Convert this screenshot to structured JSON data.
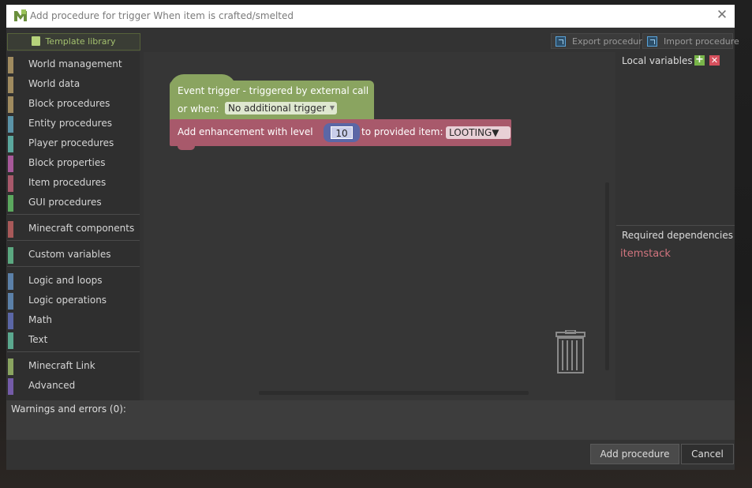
{
  "window": {
    "title": "Add procedure for trigger When item is crafted/smelted",
    "app_icon": "mcreator-logo-icon",
    "close_icon": "close-icon"
  },
  "toolbar": {
    "template_library": "Template library",
    "export_procedure": "Export procedure",
    "import_procedure": "Import procedure"
  },
  "palette": {
    "categories": [
      {
        "label": "World management",
        "color": "#a08b5f"
      },
      {
        "label": "World data",
        "color": "#a08b5f"
      },
      {
        "label": "Block procedures",
        "color": "#a08b5f"
      },
      {
        "label": "Entity procedures",
        "color": "#5b94a8"
      },
      {
        "label": "Player procedures",
        "color": "#5ba89e"
      },
      {
        "label": "Block properties",
        "color": "#a8599a"
      },
      {
        "label": "Item procedures",
        "color": "#a8596b"
      },
      {
        "label": "GUI procedures",
        "color": "#5ba85e"
      },
      {
        "label": "Minecraft components",
        "color": "#a85959"
      },
      {
        "label": "Custom variables",
        "color": "#5ba880"
      },
      {
        "label": "Logic and loops",
        "color": "#5b80a8"
      },
      {
        "label": "Logic operations",
        "color": "#5b80a8"
      },
      {
        "label": "Math",
        "color": "#5b67a6"
      },
      {
        "label": "Text",
        "color": "#5ba88e"
      },
      {
        "label": "Minecraft Link",
        "color": "#8aa460"
      },
      {
        "label": "Advanced",
        "color": "#745ba8"
      }
    ]
  },
  "workspace": {
    "event_block": {
      "line1": "Event trigger - triggered by external call",
      "line2": "or when:",
      "trigger_select": "No additional trigger",
      "color": "#8aa460"
    },
    "action_block": {
      "text_a": "Add enhancement with level",
      "level_value": "10",
      "text_b": "to provided item:",
      "enchantment_select": "LOOTING",
      "color": "#a8596b"
    },
    "trash_icon": "trash-can-icon"
  },
  "right_panel": {
    "local_variables": "Local variables",
    "add_icon": "plus-icon",
    "remove_icon": "remove-icon",
    "required_dependencies": "Required dependencies",
    "dependencies": [
      "itemstack"
    ]
  },
  "footer": {
    "warnings": "Warnings and errors (0):",
    "add_button": "Add procedure",
    "cancel_button": "Cancel"
  }
}
